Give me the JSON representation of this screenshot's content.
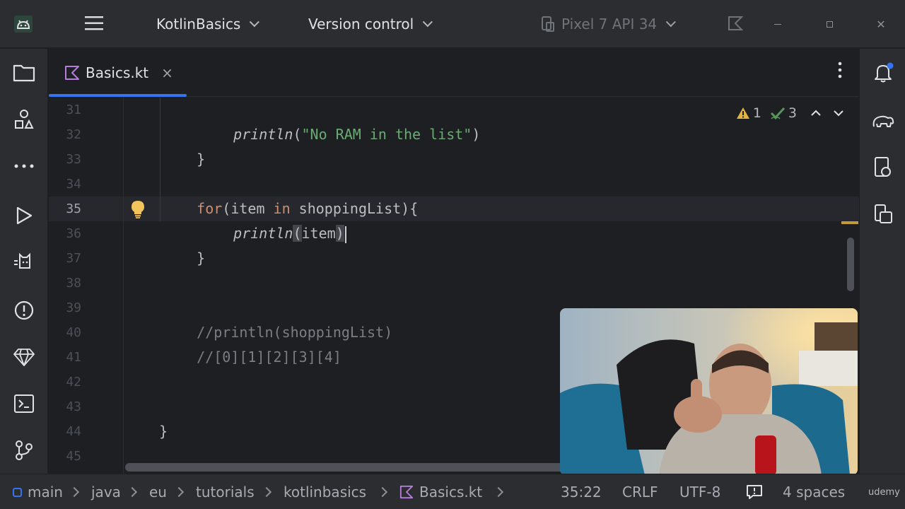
{
  "titlebar": {
    "project": "KotlinBasics",
    "vcs": "Version control",
    "device": "Pixel 7 API 34"
  },
  "tab": {
    "label": "Basics.kt",
    "close": "×"
  },
  "inspections": {
    "warnings": "1",
    "typos": "3"
  },
  "editor": {
    "line_numbers": [
      "31",
      "32",
      "33",
      "34",
      "35",
      "36",
      "37",
      "38",
      "39",
      "40",
      "41",
      "42",
      "43",
      "44",
      "45"
    ],
    "lines": {
      "l31_fn": "println",
      "l31_open": "(",
      "l31_str": "\"No RAM in the list\"",
      "l31_close": ")",
      "l32": "}",
      "l34_kw": "for",
      "l34_a": "(item ",
      "l34_in": "in",
      "l34_b": " shoppingList){",
      "l35_fn": "println",
      "l35_open": "(",
      "l35_arg": "item",
      "l35_close": ")",
      "l36": "}",
      "l39": "//println(shoppingList)",
      "l40": "//[0][1][2][3][4]",
      "l43": "}"
    }
  },
  "statusbar": {
    "crumbs": [
      "main",
      "java",
      "eu",
      "tutorials",
      "kotlinbasics",
      "Basics.kt"
    ],
    "position": "35:22",
    "line_sep": "CRLF",
    "encoding": "UTF-8",
    "indent": "4 spaces"
  },
  "watermark": "udemy",
  "colors": {
    "accent": "#3574f0",
    "keyword": "#cf8e6d",
    "string": "#6aab73",
    "comment": "#7a7e85",
    "warning": "#e3b341",
    "ok": "#57965c"
  }
}
